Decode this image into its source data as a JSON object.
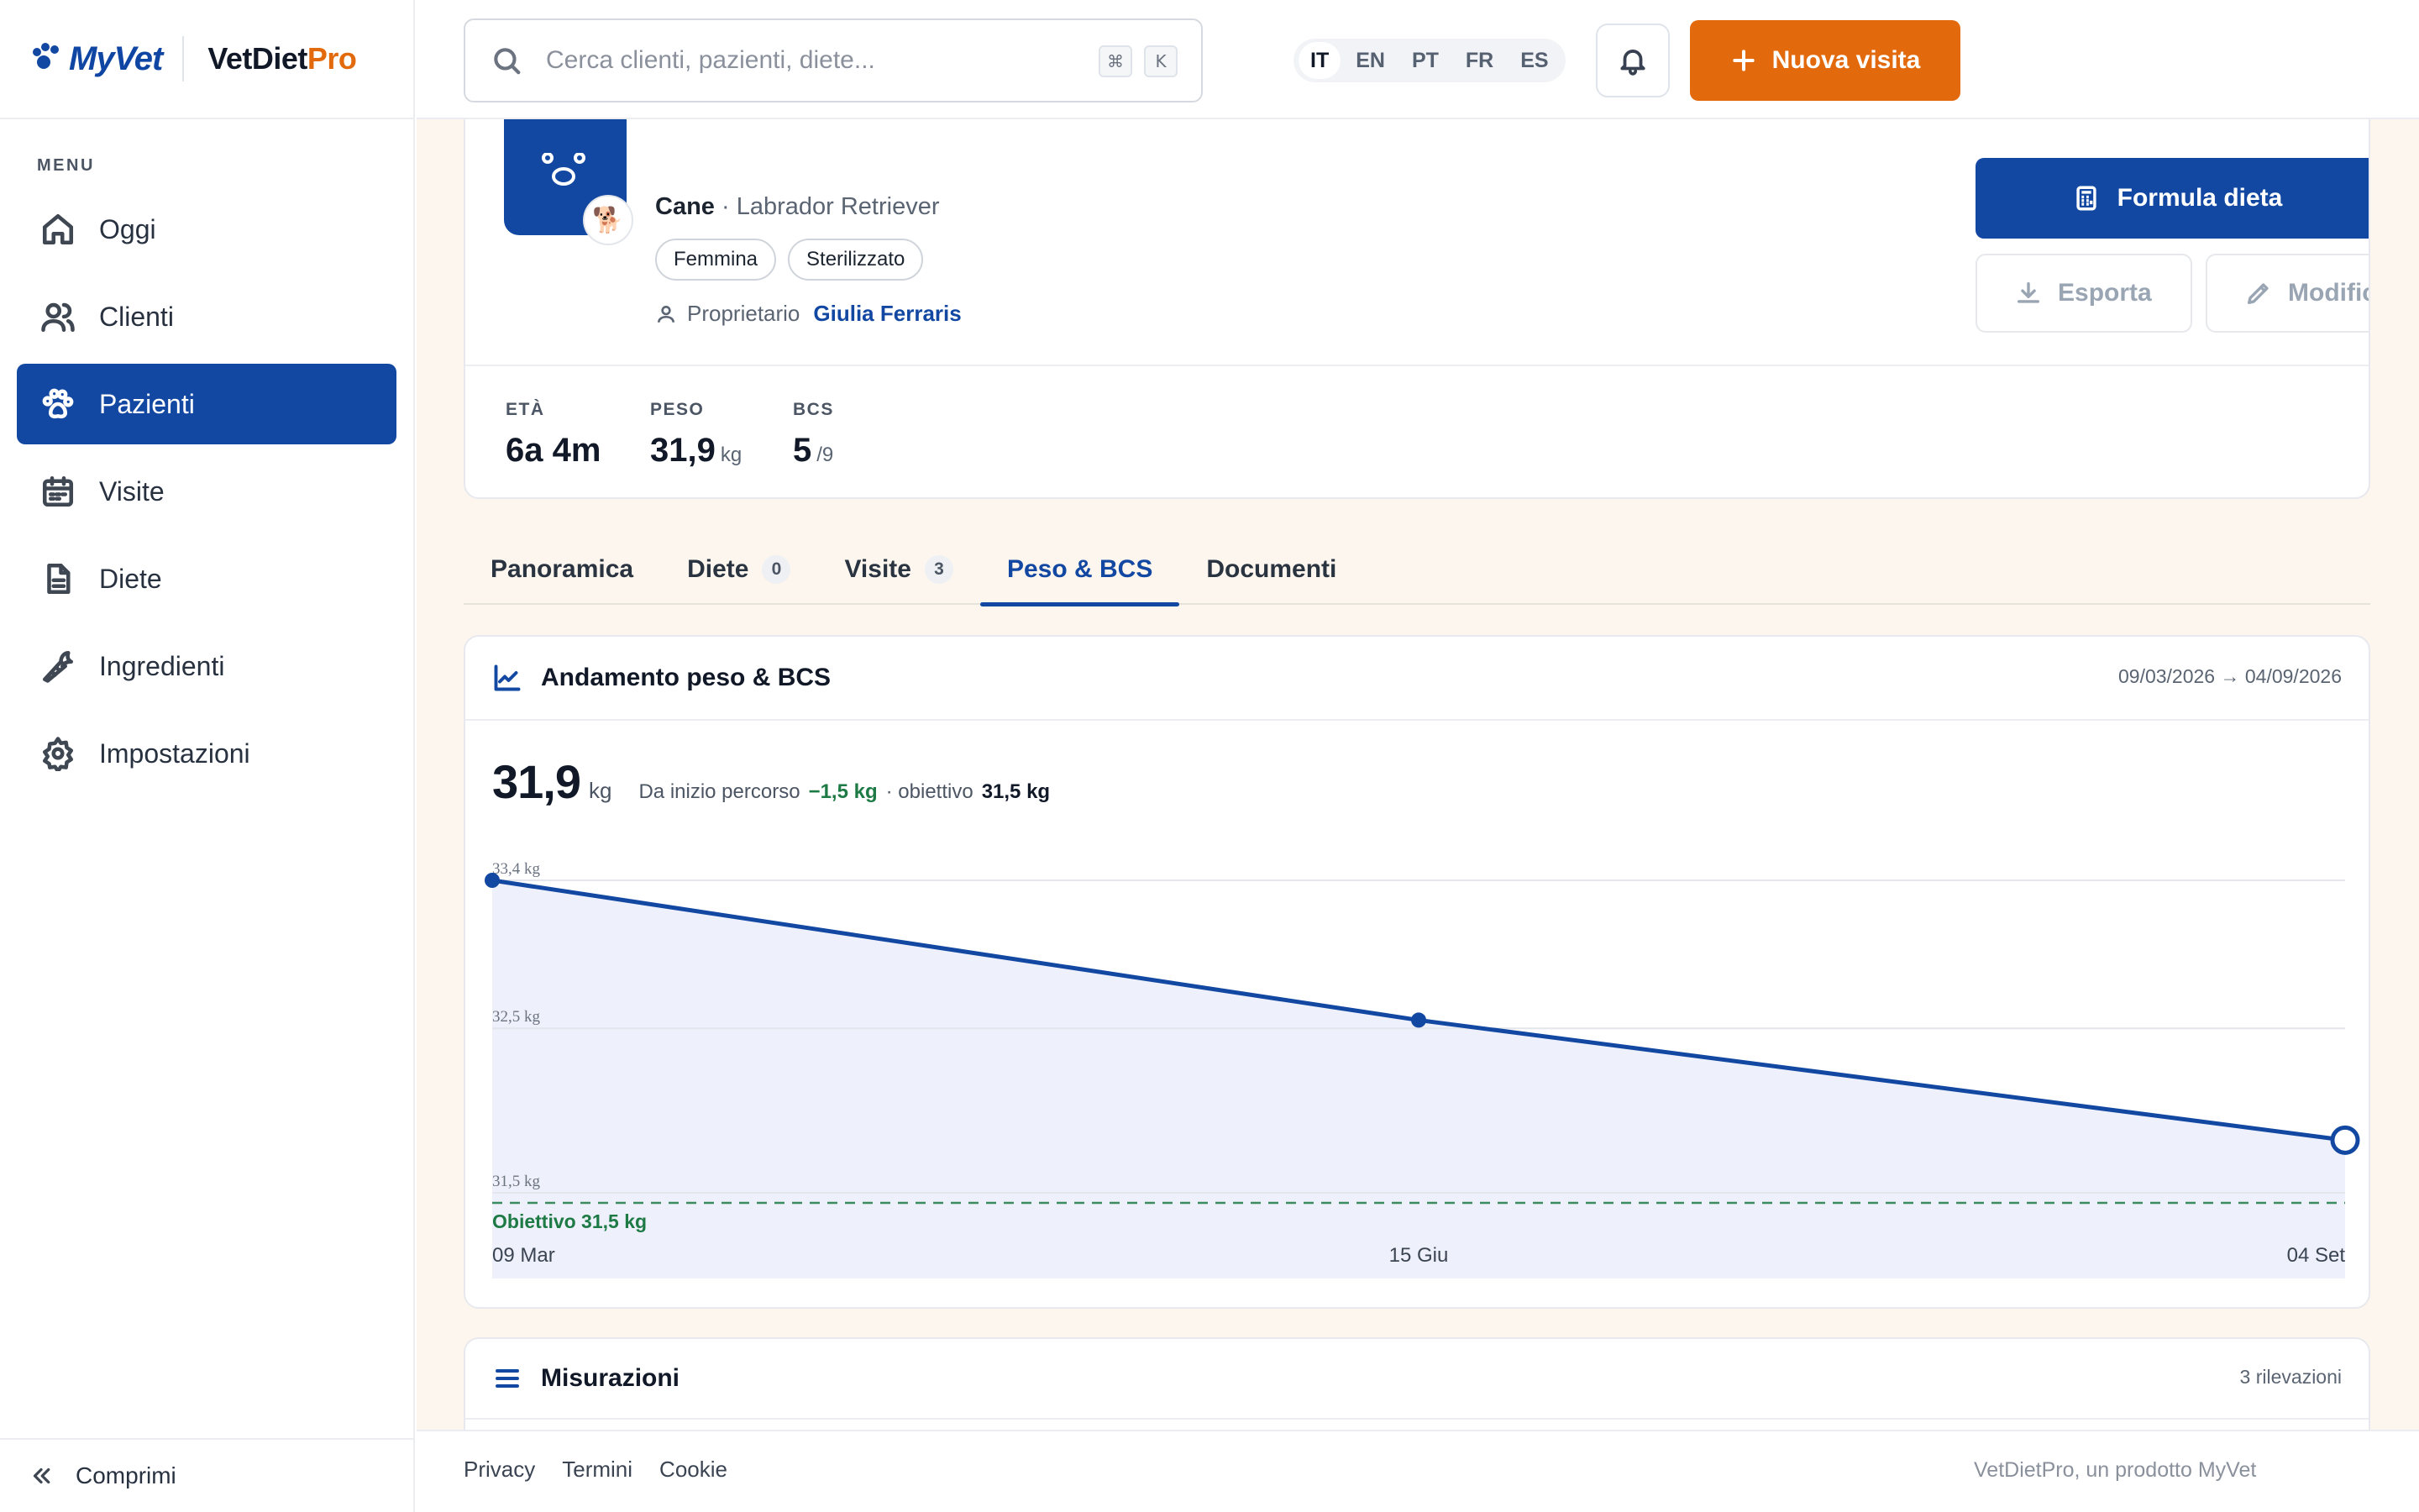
{
  "brand": {
    "logo": "MyVet",
    "product": "VetDiet",
    "product_suffix": "Pro"
  },
  "sidebar": {
    "menu_label": "MENU",
    "items": [
      {
        "label": "Oggi",
        "icon": "home-icon"
      },
      {
        "label": "Clienti",
        "icon": "users-icon"
      },
      {
        "label": "Pazienti",
        "icon": "paw-icon",
        "active": true
      },
      {
        "label": "Visite",
        "icon": "calendar-icon"
      },
      {
        "label": "Diete",
        "icon": "document-icon"
      },
      {
        "label": "Ingredienti",
        "icon": "carrot-icon"
      },
      {
        "label": "Impostazioni",
        "icon": "gear-icon"
      }
    ],
    "collapse_label": "Comprimi"
  },
  "topbar": {
    "search_placeholder": "Cerca clienti, pazienti, diete...",
    "shortcut_keys": [
      "⌘",
      "K"
    ],
    "languages": [
      "IT",
      "EN",
      "PT",
      "FR",
      "ES"
    ],
    "active_language": "IT",
    "new_visit_label": "Nuova visita"
  },
  "patient": {
    "species": "Cane",
    "breed": "· Labrador Retriever",
    "tags": [
      "Femmina",
      "Sterilizzato"
    ],
    "owner_label": "Proprietario",
    "owner_name": "Giulia Ferraris",
    "actions": {
      "formula": "Formula dieta",
      "export": "Esporta",
      "edit": "Modifica"
    },
    "stats": [
      {
        "label": "ETÀ",
        "value": "6a 4m",
        "unit": ""
      },
      {
        "label": "PESO",
        "value": "31,9",
        "unit": "kg"
      },
      {
        "label": "BCS",
        "value": "5",
        "unit": "/9"
      }
    ]
  },
  "tabs": [
    {
      "label": "Panoramica",
      "count": ""
    },
    {
      "label": "Diete",
      "count": "0"
    },
    {
      "label": "Visite",
      "count": "3"
    },
    {
      "label": "Peso & BCS",
      "count": "",
      "active": true
    },
    {
      "label": "Documenti",
      "count": ""
    }
  ],
  "weight_card": {
    "title": "Andamento peso & BCS",
    "range": "09/03/2026 → 04/09/2026",
    "current_value": "31,9",
    "current_unit": "kg",
    "since_start_label": "Da inizio percorso",
    "delta": "−1,5 kg",
    "target_label": "· obiettivo",
    "target_value": "31,5 kg"
  },
  "chart_data": {
    "type": "area",
    "x": [
      "09 Mar",
      "15 Giu",
      "04 Set"
    ],
    "x_fraction": [
      0,
      0.5,
      1
    ],
    "series": [
      {
        "values": [
          33.4,
          32.55,
          31.82
        ]
      }
    ],
    "y_ticks": [
      {
        "value": 33.4,
        "label": "33,4 kg"
      },
      {
        "value": 32.5,
        "label": "32,5 kg"
      },
      {
        "value": 31.5,
        "label": "31,5 kg"
      }
    ],
    "ylim": [
      31.5,
      33.4
    ],
    "target": {
      "value": 31.5,
      "label": "Obiettivo 31,5 kg"
    },
    "colors": {
      "line": "#1248a2",
      "fill": "#eef1fb",
      "target": "#1e7a45"
    }
  },
  "measurements": {
    "title": "Misurazioni",
    "count_label": "3 rilevazioni"
  },
  "footer": {
    "links": [
      "Privacy",
      "Termini",
      "Cookie"
    ],
    "credit": "VetDietPro, un prodotto MyVet"
  }
}
